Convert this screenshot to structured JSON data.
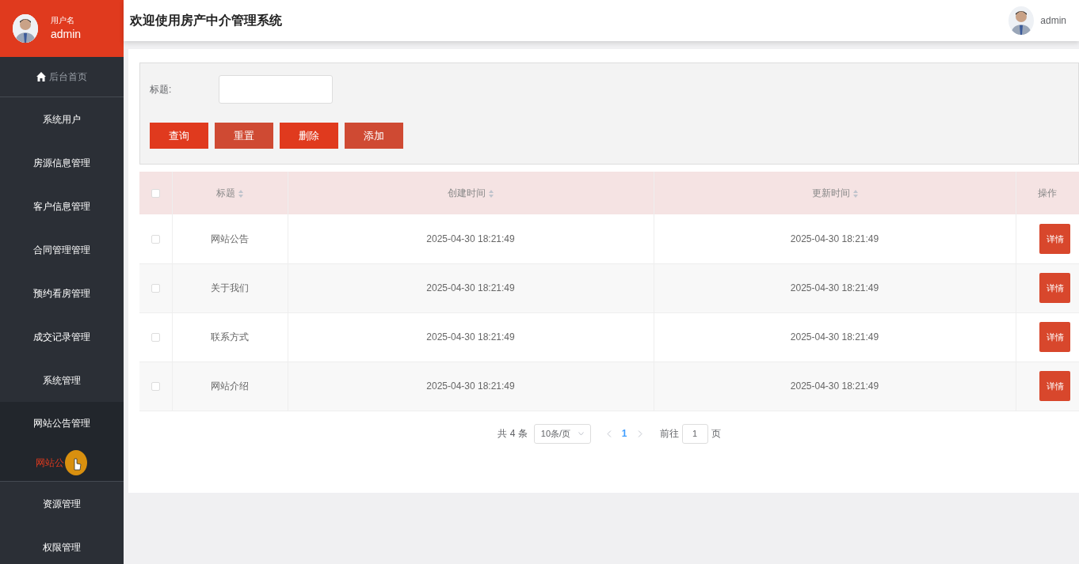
{
  "sidebar": {
    "user": {
      "label": "用户名",
      "name": "admin"
    },
    "items": [
      {
        "label": "后台首页",
        "kind": "home",
        "selected": false
      },
      {
        "label": "系统用户",
        "kind": "menu",
        "selected": false,
        "expanded": false
      },
      {
        "label": "房源信息管理",
        "kind": "menu",
        "selected": false,
        "expanded": false
      },
      {
        "label": "客户信息管理",
        "kind": "menu",
        "selected": false,
        "expanded": false
      },
      {
        "label": "合同管理管理",
        "kind": "menu",
        "selected": false,
        "expanded": false
      },
      {
        "label": "预约看房管理",
        "kind": "menu",
        "selected": false,
        "expanded": false
      },
      {
        "label": "成交记录管理",
        "kind": "menu",
        "selected": false,
        "expanded": false
      },
      {
        "label": "系统管理",
        "kind": "menu",
        "selected": false,
        "expanded": false
      },
      {
        "label": "网站公告管理",
        "kind": "menu",
        "selected": false,
        "expanded": true,
        "children": [
          {
            "label": "网站公",
            "selected": true
          }
        ]
      },
      {
        "label": "资源管理",
        "kind": "menu",
        "selected": false,
        "expanded": false
      },
      {
        "label": "权限管理",
        "kind": "menu",
        "selected": false,
        "expanded": false
      }
    ]
  },
  "header": {
    "title": "欢迎使用房产中介管理系统",
    "user": "admin"
  },
  "search": {
    "label": "标题:"
  },
  "buttons": [
    "查询",
    "重置",
    "删除",
    "添加"
  ],
  "table": {
    "select_all_checked": false,
    "columns": [
      {
        "kind": "check"
      },
      {
        "label": "标题",
        "kind": "text",
        "sortable": true
      },
      {
        "label": "创建时间",
        "kind": "text",
        "sortable": true
      },
      {
        "label": "更新时间",
        "kind": "text",
        "sortable": true
      },
      {
        "label": "操作",
        "kind": "action",
        "sortable": false
      }
    ],
    "rows": [
      {
        "checked": false,
        "title": "网站公告",
        "created": "2025-04-30 18:21:49",
        "updated": "2025-04-30 18:21:49",
        "action": "详情"
      },
      {
        "checked": false,
        "title": "关于我们",
        "created": "2025-04-30 18:21:49",
        "updated": "2025-04-30 18:21:49",
        "action": "详情"
      },
      {
        "checked": false,
        "title": "联系方式",
        "created": "2025-04-30 18:21:49",
        "updated": "2025-04-30 18:21:49",
        "action": "详情"
      },
      {
        "checked": false,
        "title": "网站介绍",
        "created": "2025-04-30 18:21:49",
        "updated": "2025-04-30 18:21:49",
        "action": "详情"
      }
    ]
  },
  "pagination": {
    "total": "共 4 条",
    "page_size": "10条/页",
    "pages": [
      {
        "label": "1",
        "selected": true
      }
    ],
    "goto_label": "前往",
    "goto_value": "1",
    "goto_suffix": "页"
  }
}
